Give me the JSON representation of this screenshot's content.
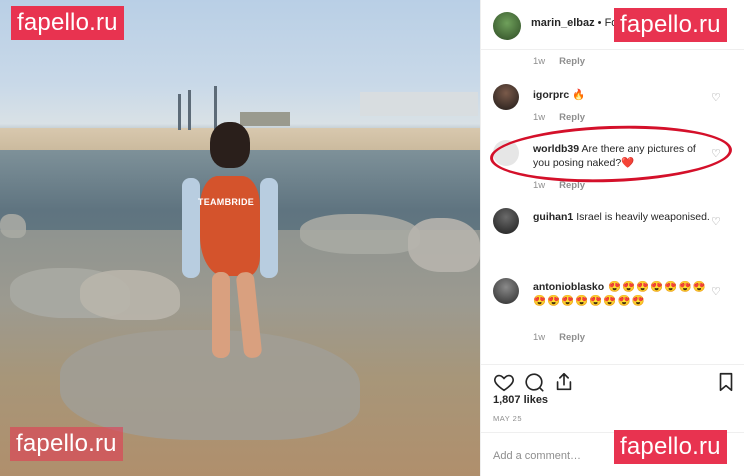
{
  "watermark": "fapello.ru",
  "photo": {
    "suit_text": "TEAMBRIDE"
  },
  "post": {
    "username": "marin_elbaz",
    "header_suffix": "• Fo"
  },
  "top_meta": {
    "time": "1w",
    "reply": "Reply"
  },
  "comments": [
    {
      "user": "igorprc",
      "text": "🔥",
      "time": "1w",
      "reply": "Reply"
    },
    {
      "user": "worldb39",
      "text": "Are there any pictures of you posing naked?❤️",
      "time": "1w",
      "reply": "Reply"
    },
    {
      "user": "guihan1",
      "text": "Israel is heavily weaponised.",
      "time": "",
      "reply": ""
    },
    {
      "user": "antonioblasko",
      "text": "😍😍😍😍😍😍😍😍😍😍😍😍😍😍😍",
      "time": "1w",
      "reply": "Reply"
    }
  ],
  "likes": "1,807 likes",
  "date": "MAY 25",
  "add_comment_placeholder": "Add a comment…",
  "icons": [
    "heart-icon",
    "comment-icon",
    "share-icon",
    "bookmark-icon"
  ],
  "colors": {
    "watermark": "#e83350",
    "highlight": "#d4102a"
  }
}
